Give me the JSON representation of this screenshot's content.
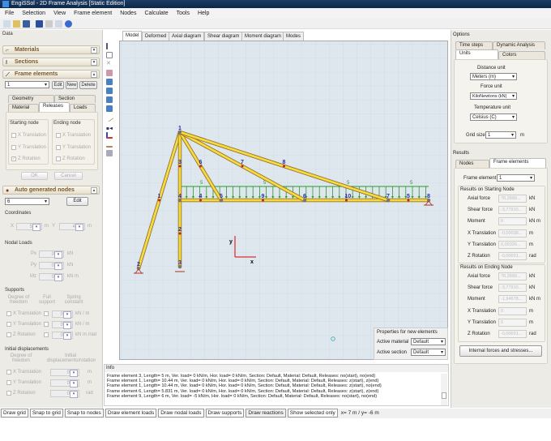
{
  "window": {
    "title": "EngiSSol - 2D Frame Analysis [Static Edition]"
  },
  "menu": [
    "File",
    "Selection",
    "View",
    "Frame element",
    "Nodes",
    "Calculate",
    "Tools",
    "Help"
  ],
  "left": {
    "data_label": "Data",
    "materials": "Materials",
    "sections": "Sections",
    "frame_elements": "Frame elements",
    "fe_selected": "1",
    "edit": "Edit",
    "new": "New",
    "delete": "Delete",
    "tabs": [
      "Geometry",
      "Section",
      "Material",
      "Releases",
      "Loads"
    ],
    "starting_node": "Starting node",
    "ending_node": "Ending node",
    "x_translation": "X Translation",
    "y_translation": "Y Translation",
    "z_rotation": "Z Rotation",
    "ok": "OK",
    "cancel": "Cancel",
    "auto_nodes": "Auto generated nodes",
    "node_selected": "6",
    "node_edit": "Edit",
    "coordinates": "Coordinates",
    "x_label": "X",
    "x_value": "5",
    "y_label": "Y",
    "y_value": "4",
    "m": "m",
    "nodal_loads": "Nodal Loads",
    "px": "Px",
    "py": "Py",
    "mz": "Mz",
    "zero": "0",
    "kn": "kN",
    "knm": "kN m",
    "supports": "Supports",
    "dof": "Degree of freedom",
    "full_support": "Full support",
    "spring": "Spring constant",
    "kn_m": "kN / m",
    "knm_rad": "kN m /rad",
    "initial_displacements": "Initial displacements",
    "init_disp": "Initial displacements/rotation",
    "rad": "rad"
  },
  "canvas": {
    "tabs": [
      "Model",
      "Deformed",
      "Axial diagram",
      "Shear diagram",
      "Moment diagram",
      "Modes"
    ],
    "node_labels": [
      "1",
      "2",
      "3",
      "4",
      "5",
      "6",
      "7",
      "8"
    ],
    "element_labels": [
      "1",
      "2",
      "3",
      "4",
      "9",
      "10",
      "5",
      "6",
      "7",
      "8"
    ],
    "load_labels": [
      "5",
      "5",
      "5",
      "5"
    ],
    "axis_x": "x",
    "axis_y": "y",
    "props_title": "Properties for new elements",
    "active_material": "Active material",
    "active_section": "Active section",
    "default": "Default"
  },
  "info": {
    "title": "Info",
    "lines": [
      "Frame element 3, Length= 5 m, Ver. load= 0 kN/m, Hor. load= 0 kN/m, Section: Default, Material: Default, Releases: no(start), no(end)",
      "Frame element 1, Length= 10.44 m, Ver. load= 0 kN/m, Hor. load= 0 kN/m, Section: Default, Material: Default, Releases: z(start), z(end)",
      "Frame element 1, Length= 10.44 m, Ver. load= 0 kN/m, Hor. load= 0 kN/m, Section: Default, Material: Default, Releases: z(start), no(end)",
      "Frame element 6, Length= 5.831 m, Ver. load= 0 kN/m, Hor. load= 0 kN/m, Section: Default, Material: Default, Releases: z(start), z(end)",
      "Frame element 9, Length= 6 m, Ver. load= -5 kN/m, Hor. load= 0 kN/m, Section: Default, Material: Default, Releases: no(start), no(end)"
    ]
  },
  "status": [
    "Draw grid",
    "Snap to grid",
    "Snap to nodes",
    "Draw element loads",
    "Draw nodal loads",
    "Draw supports",
    "Draw reactions",
    "Show selected only"
  ],
  "coords": "x= 7 m / y= -6 m",
  "options": {
    "title": "Options",
    "tabs": [
      "Time steps",
      "Dynamic Analysis",
      "Units",
      "Colors"
    ],
    "distance_unit": "Distance unit",
    "distance_value": "Meters (m)",
    "force_unit": "Force unit",
    "force_value": "KiloNewtons (kN)",
    "temp_unit": "Temperature unit",
    "temp_value": "Celsius (C)",
    "grid_size": "Grid size",
    "grid_value": "1",
    "grid_m": "m"
  },
  "results": {
    "title": "Results",
    "tabs": [
      "Nodes",
      "Frame elements"
    ],
    "frame_element": "Frame element",
    "fe_value": "1",
    "start_title": "Results on Starting Node",
    "end_title": "Results on Ending Node",
    "rows": [
      "Axial force",
      "Shear force",
      "Moment",
      "X Translation",
      "Y Translation",
      "Z Rotation"
    ],
    "units": [
      "kN",
      "kN",
      "kN m",
      "m",
      "m",
      "rad"
    ],
    "start_values": [
      "78,2890...",
      "-3,77910...",
      "0",
      "-0,00038...",
      "0,00326...",
      "-0,00031..."
    ],
    "end_values": [
      "78,2890...",
      "-3,77910...",
      "-1,94678...",
      "0",
      "0",
      "-0,00031..."
    ],
    "internal_btn": "Internal forces and stresses..."
  }
}
